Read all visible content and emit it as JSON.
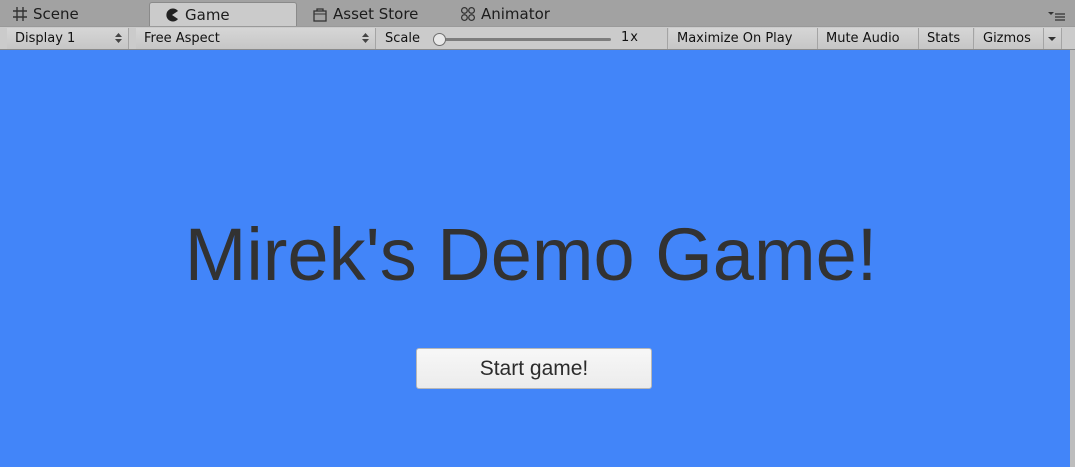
{
  "tabs": [
    {
      "label": "Scene",
      "icon": "grid-icon",
      "active": false
    },
    {
      "label": "Game",
      "icon": "pacman-icon",
      "active": true
    },
    {
      "label": "Asset Store",
      "icon": "store-bag-icon",
      "active": false
    },
    {
      "label": "Animator",
      "icon": "animator-nodes-icon",
      "active": false
    }
  ],
  "toolbar": {
    "display": "Display 1",
    "aspect": "Free Aspect",
    "scale_label": "Scale",
    "scale_value": "1x",
    "scale_fraction": 0.0,
    "maximize_on_play": "Maximize On Play",
    "mute_audio": "Mute Audio",
    "stats": "Stats",
    "gizmos": "Gizmos"
  },
  "game": {
    "title": "Mirek's Demo Game!",
    "start_button": "Start game!"
  },
  "colors": {
    "game_background": "#4285f9",
    "title_text": "#323232",
    "panel": "#cbcbcb",
    "tab_strip": "#a2a2a2"
  }
}
